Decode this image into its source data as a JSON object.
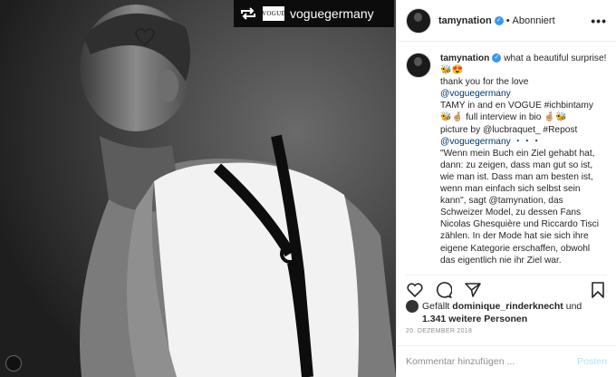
{
  "post": {
    "repost_handle": "voguegermany",
    "repost_logo": "VOGUE"
  },
  "header": {
    "username": "tamynation",
    "separator": "•",
    "follow_status": "Abonniert",
    "more": "•••"
  },
  "caption": {
    "username": "tamynation",
    "lines": [
      "what a beautiful surprise! 🐝😍",
      "thank you for the love",
      "@voguegermany",
      "TAMY in and en VOGUE #ichbintamy",
      "🐝🤞🏼 full interview in bio 🤞🏼🐝",
      "picture by @lucbraquet_ #Repost",
      "@voguegermany ・・・",
      "\"Wenn mein Buch ein Ziel gehabt hat, dann: zu zeigen, dass man gut so ist, wie man ist. Dass man am besten ist, wenn man einfach sich selbst sein kann\", sagt @tamynation, das Schweizer Model, zu dessen Fans Nicolas Ghesquière und Riccardo Tisci zählen. In der Mode hat sie sich ihre eigene Kategorie erschaffen, obwohl das eigentlich nie ihr Ziel war."
    ]
  },
  "likes": {
    "prefix": "Gefällt",
    "user": "dominique_rinderknecht",
    "mid": "und",
    "count": "1.341 weitere Personen"
  },
  "date": "20. DEZEMBER 2018",
  "comment_box": {
    "placeholder": "Kommentar hinzufügen ...",
    "post_label": "Posten"
  },
  "icons": [
    "heart-icon",
    "comment-icon",
    "share-icon",
    "bookmark-icon",
    "repost-icon",
    "verified-badge-icon",
    "more-icon"
  ]
}
